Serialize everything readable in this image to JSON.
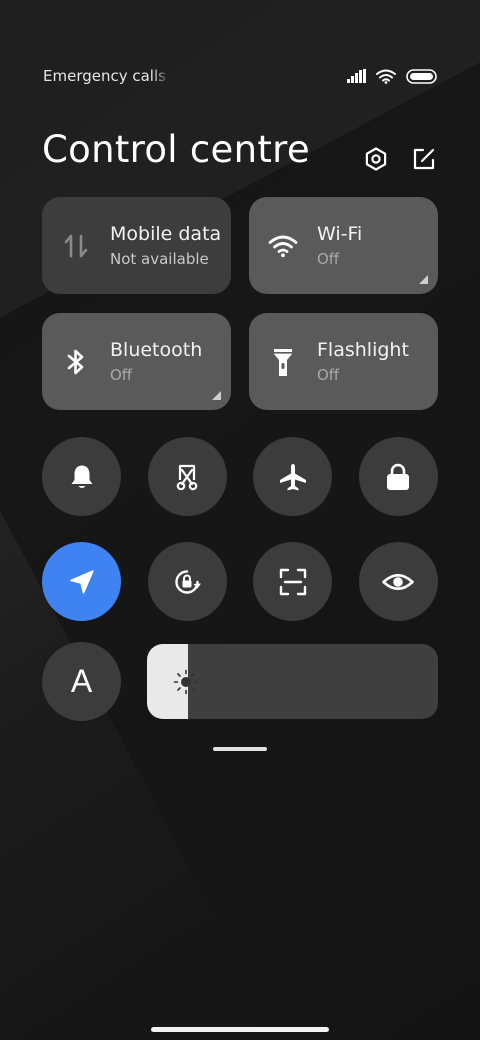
{
  "status_bar": {
    "carrier_text": "Emergency calls only",
    "icons": [
      "signal-icon",
      "wifi-icon",
      "battery-icon"
    ]
  },
  "header": {
    "title": "Control centre",
    "icons": [
      "settings-icon",
      "edit-icon"
    ]
  },
  "tiles": [
    {
      "label": "Mobile data",
      "sub": "Not available",
      "icon": "mobile-data-icon",
      "state": "dark"
    },
    {
      "label": "Wi-Fi",
      "sub": "Off",
      "icon": "wifi-icon",
      "state": "light"
    },
    {
      "label": "Bluetooth",
      "sub": "Off",
      "icon": "bluetooth-icon",
      "state": "light"
    },
    {
      "label": "Flashlight",
      "sub": "Off",
      "icon": "flashlight-icon",
      "state": "light"
    }
  ],
  "toggles": [
    {
      "icon": "bell-icon",
      "active": false
    },
    {
      "icon": "screenshot-icon",
      "active": false
    },
    {
      "icon": "airplane-icon",
      "active": false
    },
    {
      "icon": "lock-icon",
      "active": false
    },
    {
      "icon": "location-icon",
      "active": true
    },
    {
      "icon": "rotation-lock-icon",
      "active": false
    },
    {
      "icon": "scanner-icon",
      "active": false
    },
    {
      "icon": "eye-icon",
      "active": false
    },
    {
      "icon": "font-icon",
      "active": false
    }
  ],
  "font_toggle_label": "A",
  "brightness": {
    "level": 0.14
  },
  "colors": {
    "accent": "#3f82f2",
    "tile_light": "#5a5a5a",
    "tile_dark": "#3d3d3d",
    "toggle": "#3c3c3c"
  }
}
